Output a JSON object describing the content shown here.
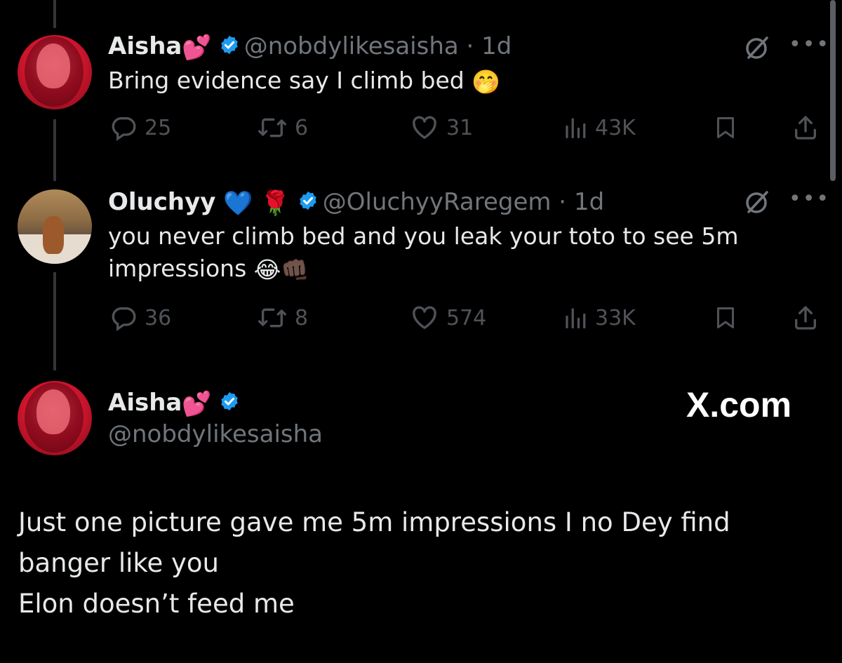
{
  "replies": [
    {
      "name": "Aisha",
      "name_emojis": [
        "💕"
      ],
      "verified": true,
      "handle": "@nobdylikesaisha",
      "separator": "·",
      "time": "1d",
      "text": "Bring evidence say I climb bed",
      "text_emoji": "🤭",
      "metrics": {
        "replies": "25",
        "reposts": "6",
        "likes": "31",
        "views": "43K"
      }
    },
    {
      "name": "Oluchyy",
      "name_emojis": [
        "💙",
        "🌹"
      ],
      "verified": true,
      "handle": "@OluchyyRaregem",
      "separator": "·",
      "time": "1d",
      "text_line1": "you never climb bed and you leak your toto to see 5m",
      "text_line2": "impressions",
      "text_emoji": "😂👊🏿",
      "metrics": {
        "replies": "36",
        "reposts": "8",
        "likes": "574",
        "views": "33K"
      }
    }
  ],
  "main_tweet": {
    "name": "Aisha",
    "name_emoji": "💕",
    "verified": true,
    "handle": "@nobdylikesaisha",
    "watermark": "X.com",
    "text_lines": [
      "Just one picture gave me 5m impressions I no Dey find",
      "banger like you",
      "Elon doesn’t feed me"
    ]
  },
  "colors": {
    "background": "#000000",
    "text": "#e7e9ea",
    "muted": "#71767b",
    "action_icons": "#4f5358",
    "verified_badge": "#1d9bf0",
    "thread_line": "#333639"
  },
  "icons": [
    "reply-icon",
    "repost-icon",
    "like-icon",
    "views-icon",
    "bookmark-icon",
    "share-icon",
    "grok-icon",
    "more-icon",
    "verified-badge-icon"
  ]
}
